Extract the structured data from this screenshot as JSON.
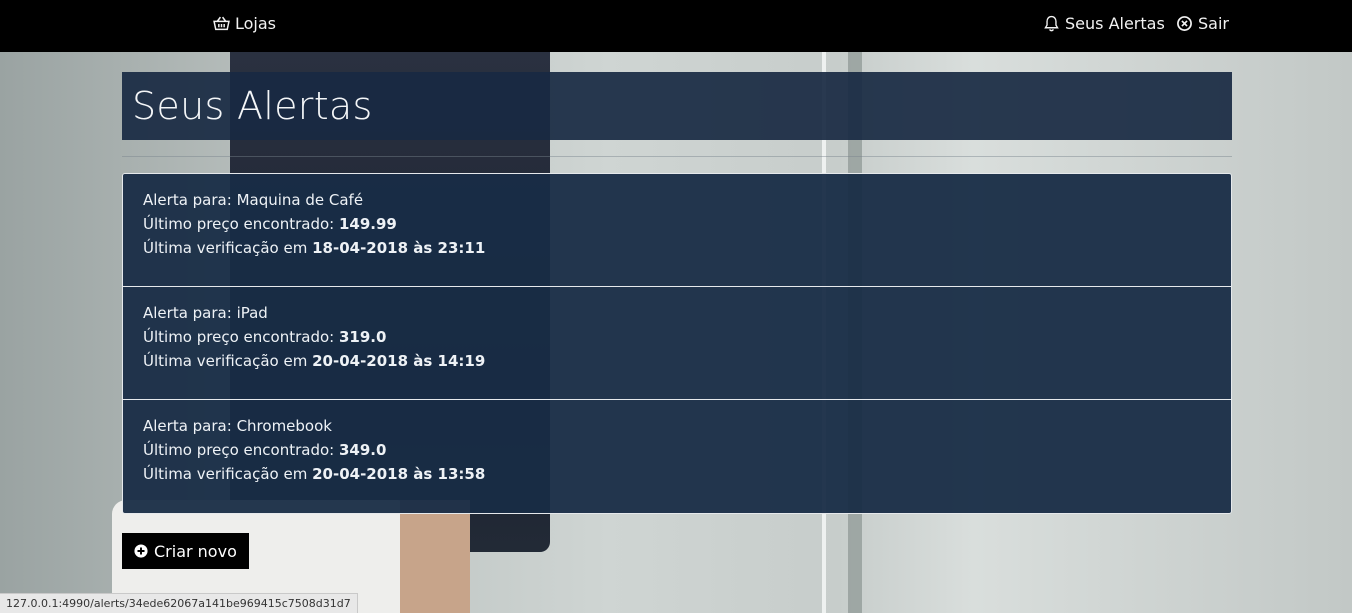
{
  "navbar": {
    "stores_label": "Lojas",
    "alerts_label": "Seus Alertas",
    "logout_label": "Sair"
  },
  "page": {
    "title": "Seus Alertas"
  },
  "labels": {
    "alert_for": "Alerta para:",
    "last_price": "Último preço encontrado:",
    "last_check": "Última verificação em"
  },
  "alerts": [
    {
      "name": "Maquina de Café",
      "price": "149.99",
      "checked": "18-04-2018 às 23:11"
    },
    {
      "name": "iPad",
      "price": "319.0",
      "checked": "20-04-2018 às 14:19"
    },
    {
      "name": "Chromebook",
      "price": "349.0",
      "checked": "20-04-2018 às 13:58"
    }
  ],
  "actions": {
    "create_new": "Criar novo"
  },
  "statusbar": {
    "url": "127.0.0.1:4990/alerts/34ede62067a141be969415c7508d31d7"
  },
  "icons": {
    "stores": "basket-icon",
    "alerts": "bell-icon",
    "logout": "close-circle-icon",
    "create": "plus-circle-icon"
  }
}
